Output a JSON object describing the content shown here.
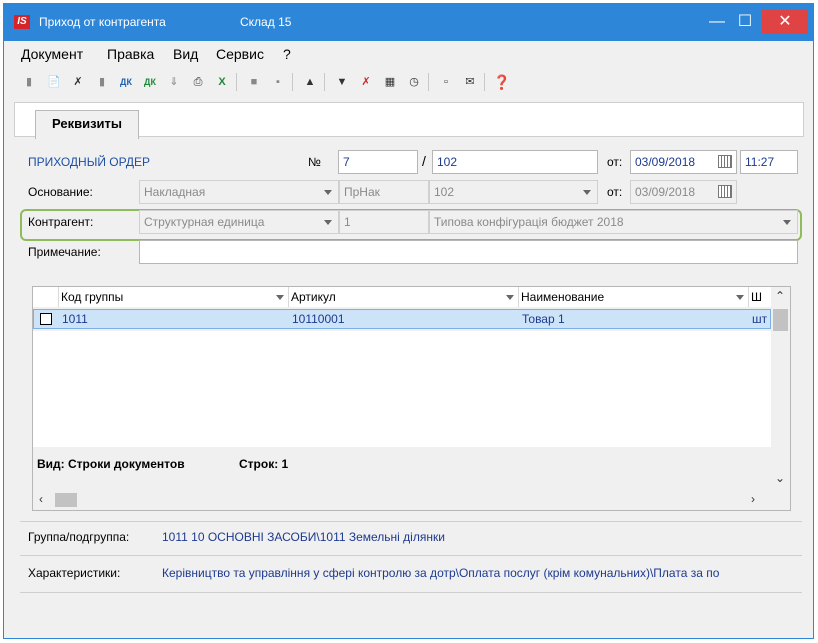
{
  "window": {
    "app_logo": "IS",
    "title": "Приход от контрагента",
    "subtitle": "Склад 15",
    "controls": [
      "minimize-icon",
      "maximize-icon",
      "close-icon"
    ]
  },
  "menu": [
    "Документ",
    "Правка",
    "Вид",
    "Сервис",
    "?"
  ],
  "toolbar": {
    "icons": [
      "copy-icon",
      "new-doc-icon",
      "delete-doc-icon",
      "paste-icon",
      "dk-icon",
      "dk-debit-icon",
      "move-down-icon",
      "print-icon",
      "excel-icon",
      "save-icon",
      "stamp-icon",
      "tree-icon",
      "filter-icon",
      "clear-filter-icon",
      "table-icon",
      "history-icon",
      "document-icon",
      "mail-icon",
      "help-icon"
    ],
    "dk_label": "ДК",
    "dk2_label": "ДК"
  },
  "tabs": [
    {
      "label": "Реквизиты"
    }
  ],
  "form": {
    "order_type": "ПРИХОДНЫЙ ОРДЕР",
    "number_label": "№",
    "number": "7",
    "slash": "/",
    "number2": "102",
    "date_label": "от:",
    "date": "03/09/2018",
    "time": "11:27",
    "basis_label": "Основание:",
    "basis_type": "Накладная",
    "basis_code": "ПрНак",
    "basis_number": "102",
    "basis_date_label": "от:",
    "basis_date": "03/09/2018",
    "contractor_label": "Контрагент:",
    "contractor_type": "Структурная единица",
    "contractor_code": "1",
    "contractor_name": "Типова конфігурація бюджет 2018",
    "note_label": "Примечание:",
    "note": ""
  },
  "grid": {
    "columns": [
      "Код группы",
      "Артикул",
      "Наименование",
      "Ш"
    ],
    "rows": [
      {
        "group_code": "1011",
        "article": "10110001",
        "name": "Товар 1",
        "unit": "шт"
      }
    ],
    "view_label": "Вид: Строки документов",
    "rows_count_label": "Строк: 1"
  },
  "footer": {
    "group_label": "Группа/подгруппа:",
    "group_value": "1011 10 ОСНОВНІ ЗАСОБИ\\1011 Земельні ділянки",
    "chars_label": "Характеристики:",
    "chars_value": "Керівництво та управління у сфері контролю за дотр\\Оплата послуг (крім комунальних)\\Плата за по"
  }
}
